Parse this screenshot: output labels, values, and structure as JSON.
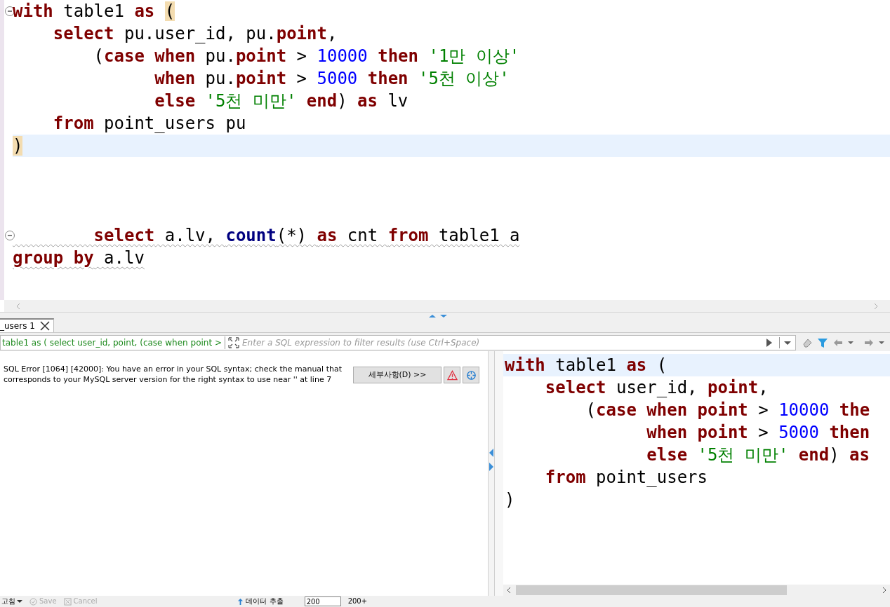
{
  "editor": {
    "lines": [
      {
        "foldable": true,
        "current": false,
        "error": false,
        "tokens": [
          {
            "kind": "kw",
            "text": "with"
          },
          {
            "kind": "plain",
            "text": " table1 "
          },
          {
            "kind": "kw",
            "text": "as "
          },
          {
            "kind": "bracket",
            "text": "("
          }
        ]
      },
      {
        "current": false,
        "error": false,
        "tokens": [
          {
            "kind": "kw",
            "text": "    select"
          },
          {
            "kind": "plain",
            "text": " pu.user_id, pu."
          },
          {
            "kind": "kw",
            "text": "point"
          },
          {
            "kind": "plain",
            "text": ","
          }
        ]
      },
      {
        "current": false,
        "error": false,
        "tokens": [
          {
            "kind": "plain",
            "text": "        ("
          },
          {
            "kind": "kw",
            "text": "case when"
          },
          {
            "kind": "plain",
            "text": " pu."
          },
          {
            "kind": "kw",
            "text": "point"
          },
          {
            "kind": "plain",
            "text": " > "
          },
          {
            "kind": "num",
            "text": "10000"
          },
          {
            "kind": "kw",
            "text": " then "
          },
          {
            "kind": "str",
            "text": "'1만 이상'"
          }
        ]
      },
      {
        "current": false,
        "error": false,
        "tokens": [
          {
            "kind": "kw",
            "text": "              when"
          },
          {
            "kind": "plain",
            "text": " pu."
          },
          {
            "kind": "kw",
            "text": "point"
          },
          {
            "kind": "plain",
            "text": " > "
          },
          {
            "kind": "num",
            "text": "5000"
          },
          {
            "kind": "kw",
            "text": " then "
          },
          {
            "kind": "str",
            "text": "'5천 이상'"
          }
        ]
      },
      {
        "current": false,
        "error": false,
        "tokens": [
          {
            "kind": "kw",
            "text": "              else "
          },
          {
            "kind": "str",
            "text": "'5천 미만'"
          },
          {
            "kind": "kw",
            "text": " end"
          },
          {
            "kind": "plain",
            "text": ") "
          },
          {
            "kind": "kw",
            "text": "as"
          },
          {
            "kind": "plain",
            "text": " lv"
          }
        ]
      },
      {
        "current": false,
        "error": false,
        "tokens": [
          {
            "kind": "kw",
            "text": "    from"
          },
          {
            "kind": "plain",
            "text": " point_users pu"
          }
        ]
      },
      {
        "current": true,
        "error": false,
        "tokens": [
          {
            "kind": "bracket",
            "text": ")"
          }
        ]
      },
      {
        "current": false
      },
      {
        "current": false
      },
      {
        "current": false
      },
      {
        "foldable": true,
        "current": false,
        "error": true,
        "tokens": [
          {
            "kind": "kw",
            "text": "        select"
          },
          {
            "kind": "plain",
            "text": " a.lv, "
          },
          {
            "kind": "fn",
            "text": "count"
          },
          {
            "kind": "plain",
            "text": "(*) "
          },
          {
            "kind": "kw",
            "text": "as"
          },
          {
            "kind": "plain",
            "text": " cnt "
          },
          {
            "kind": "kw",
            "text": "from"
          },
          {
            "kind": "plain",
            "text": " table1 a"
          }
        ]
      },
      {
        "current": false,
        "error": true,
        "tokens": [
          {
            "kind": "kw",
            "text": "group by"
          },
          {
            "kind": "plain",
            "text": " a.lv"
          }
        ]
      }
    ]
  },
  "results": {
    "tabs": [
      {
        "label": "_users 1",
        "selected": true
      }
    ],
    "filter": {
      "query": "table1 as ( select user_id, point, (case when point >",
      "placeholder": "Enter a SQL expression to filter results (use Ctrl+Space)"
    },
    "error": {
      "message": "SQL Error [1064] [42000]: You have an error in your SQL syntax; check the manual that corresponds to your MySQL server version for the right syntax to use near '' at line 7",
      "details_button": "세부사항(D) >>"
    },
    "query_lines": [
      {
        "current": true,
        "tokens": [
          {
            "kind": "kw",
            "text": "with"
          },
          {
            "kind": "plain",
            "text": " table1 "
          },
          {
            "kind": "kw",
            "text": "as"
          },
          {
            "kind": "plain",
            "text": " ("
          }
        ]
      },
      {
        "current": false,
        "tokens": [
          {
            "kind": "kw",
            "text": "    select"
          },
          {
            "kind": "plain",
            "text": " user_id, "
          },
          {
            "kind": "kw",
            "text": "point"
          },
          {
            "kind": "plain",
            "text": ","
          }
        ]
      },
      {
        "current": false,
        "tokens": [
          {
            "kind": "plain",
            "text": "        ("
          },
          {
            "kind": "kw",
            "text": "case when point"
          },
          {
            "kind": "plain",
            "text": " > "
          },
          {
            "kind": "num",
            "text": "10000"
          },
          {
            "kind": "kw",
            "text": " the"
          }
        ]
      },
      {
        "current": false,
        "tokens": [
          {
            "kind": "kw",
            "text": "              when point"
          },
          {
            "kind": "plain",
            "text": " > "
          },
          {
            "kind": "num",
            "text": "5000"
          },
          {
            "kind": "kw",
            "text": " then"
          }
        ]
      },
      {
        "current": false,
        "tokens": [
          {
            "kind": "kw",
            "text": "              else "
          },
          {
            "kind": "str",
            "text": "'5천 미만'"
          },
          {
            "kind": "kw",
            "text": " end"
          },
          {
            "kind": "plain",
            "text": ") "
          },
          {
            "kind": "kw",
            "text": "as"
          }
        ]
      },
      {
        "current": false,
        "tokens": [
          {
            "kind": "kw",
            "text": "    from"
          },
          {
            "kind": "plain",
            "text": " point_users"
          }
        ]
      },
      {
        "current": false,
        "tokens": [
          {
            "kind": "plain",
            "text": ")"
          }
        ]
      }
    ]
  },
  "toolbar": [
    {
      "kind": "refresh",
      "label": "고침",
      "disabled": false
    },
    {
      "kind": "save",
      "label": "Save",
      "disabled": true
    },
    {
      "kind": "cancel",
      "label": "Cancel",
      "disabled": true
    },
    {
      "kind": "export",
      "label": "데이터 추출",
      "disabled": false
    },
    {
      "kind": "fetch",
      "value": "200"
    },
    {
      "kind": "count",
      "label": "200+"
    }
  ]
}
